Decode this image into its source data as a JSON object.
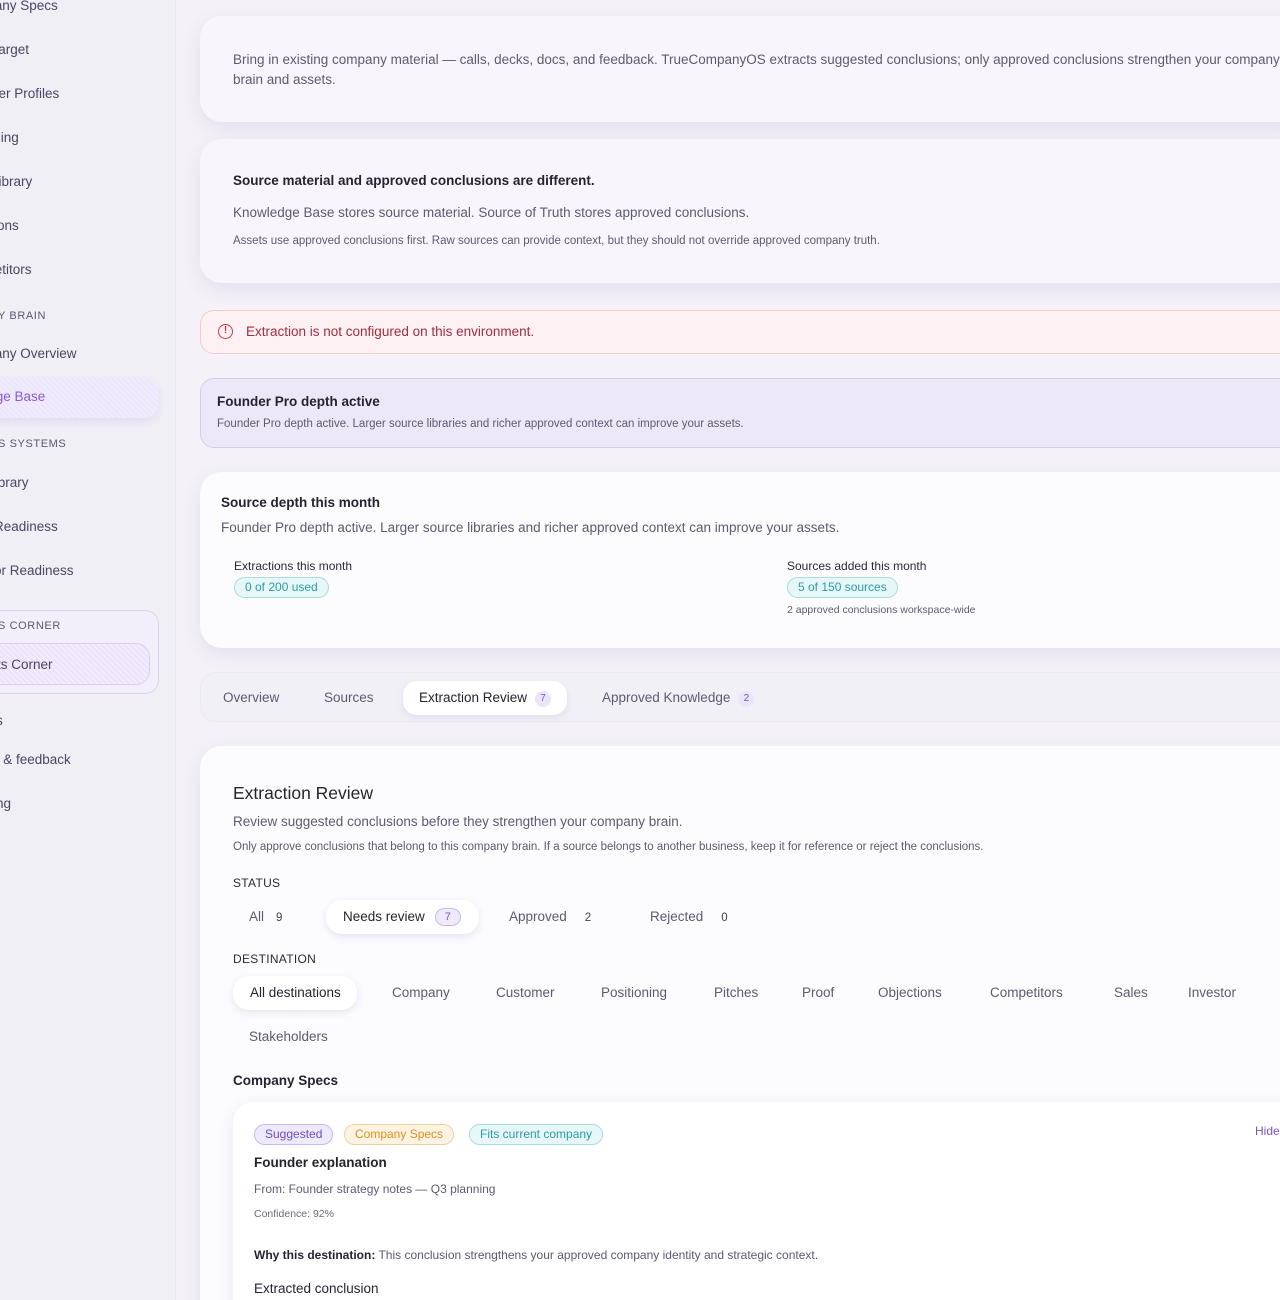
{
  "sidebar": {
    "items_top": [
      "mpany Specs",
      "rp Target",
      "tomer Profiles",
      "itioning",
      "of Library",
      "ections",
      "mpetitors"
    ],
    "section_brain": "Y BRAIN",
    "brain_items": [
      "mpany Overview",
      "wledge Base"
    ],
    "section_systems": "S SYSTEMS",
    "systems_items": [
      "h Library",
      "es Readiness",
      "estor Readiness"
    ],
    "section_corner": "S CORNER",
    "corner_item": "ssets Corner",
    "bottom_items": [
      "s",
      "p & feedback",
      "ng"
    ]
  },
  "intro": {
    "text": "Bring in existing company material — calls, decks, docs, and feedback. TrueCompanyOS extracts suggested conclusions; only approved conclusions strengthen your company brain and assets."
  },
  "source_truth": {
    "title": "Source material and approved conclusions are different.",
    "line1": "Knowledge Base stores source material. Source of Truth stores approved conclusions.",
    "line2": "Assets use approved conclusions first. Raw sources can provide context, but they should not override approved company truth."
  },
  "alert": {
    "icon": "alert-circle-icon",
    "glyph": "!",
    "text": "Extraction is not configured on this environment."
  },
  "tier": {
    "title": "Founder Pro depth active",
    "text": "Founder Pro depth active. Larger source libraries and richer approved context can improve your assets."
  },
  "depth": {
    "title": "Source depth this month",
    "text": "Founder Pro depth active. Larger source libraries and richer approved context can improve your assets.",
    "extractions_label": "Extractions this month",
    "extractions_value": "0 of 200 used",
    "sources_label": "Sources added this month",
    "sources_value": "5 of 150 sources",
    "sources_sub": "2 approved conclusions workspace-wide"
  },
  "tabs": [
    {
      "label": "Overview"
    },
    {
      "label": "Sources"
    },
    {
      "label": "Extraction Review",
      "count": "7"
    },
    {
      "label": "Approved Knowledge",
      "count": "2"
    }
  ],
  "review": {
    "title": "Extraction Review",
    "desc1": "Review suggested conclusions before they strengthen your company brain.",
    "desc2": "Only approve conclusions that belong to this company brain. If a source belongs to another business, keep it for reference or reject the conclusions.",
    "status_label": "STATUS",
    "status": [
      {
        "label": "All",
        "count": "9"
      },
      {
        "label": "Needs review",
        "count": "7"
      },
      {
        "label": "Approved",
        "count": "2"
      },
      {
        "label": "Rejected",
        "count": "0"
      }
    ],
    "destination_label": "DESTINATION",
    "destinations": [
      "All destinations",
      "Company",
      "Customer",
      "Positioning",
      "Pitches",
      "Proof",
      "Objections",
      "Competitors",
      "Sales",
      "Investor",
      "Stakeholders"
    ],
    "section": "Company Specs",
    "item": {
      "tag_status": "Suggested",
      "tag_category": "Company Specs",
      "tag_fit": "Fits current company",
      "hide": "Hide",
      "title": "Founder explanation",
      "from": "From: Founder strategy notes — Q3 planning",
      "confidence": "Confidence: 92%",
      "why_label": "Why this destination:",
      "why_text": " This conclusion strengthens your approved company identity and strategic context.",
      "extracted_label": "Extracted conclusion"
    }
  },
  "colors": {
    "accent": "#7b55c8",
    "teal": "#2a9ea6",
    "orange": "#e2901c",
    "error": "#c23a4a"
  }
}
